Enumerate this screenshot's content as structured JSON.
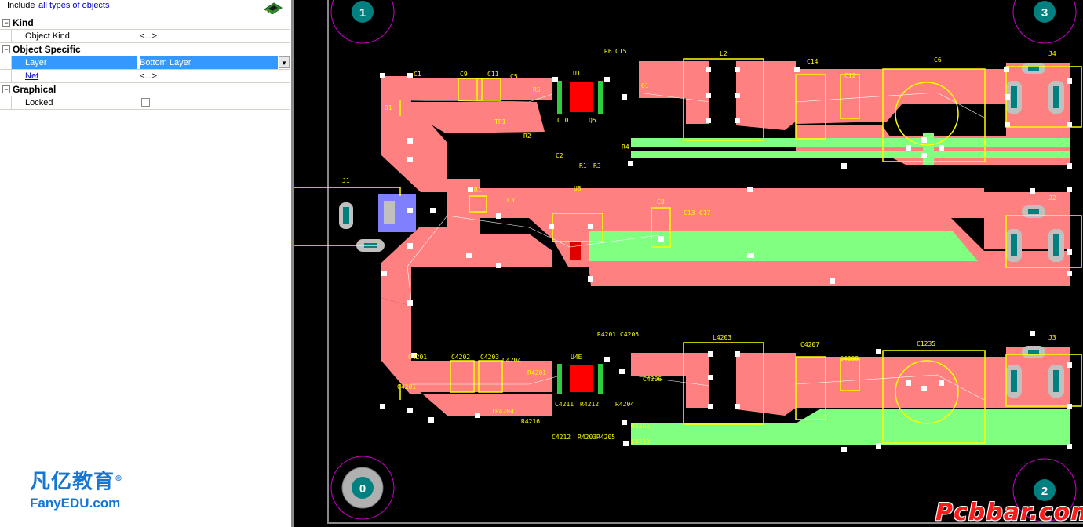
{
  "inspector": {
    "include_label": "Include",
    "include_link": "all types of objects",
    "categories": {
      "kind": "Kind",
      "object_specific": "Object Specific",
      "graphical": "Graphical"
    },
    "properties": {
      "object_kind": {
        "name": "Object Kind",
        "value": "<...>"
      },
      "layer": {
        "name": "Layer",
        "value": "Bottom Layer"
      },
      "net": {
        "name": "Net",
        "value": "<...>"
      },
      "locked": {
        "name": "Locked",
        "checked": false
      }
    },
    "toggle_symbol": "−"
  },
  "logo": {
    "cn_text": "凡亿教育",
    "reg_mark": "®",
    "en_text": "FanyEDU.com"
  },
  "watermark": "Pcbbar.com",
  "pcb": {
    "colors": {
      "board": "#000000",
      "top_copper": "#ff8080",
      "bottom_copper": "#80ff80",
      "overlay": "#ffff00",
      "mech": "#cc00cc",
      "pad": "#c0c0c0",
      "selected": "#8080ff"
    },
    "mount_holes": [
      "1",
      "3",
      "0",
      "2"
    ],
    "designators": {
      "top": [
        "L2",
        "C14",
        "C12",
        "C6",
        "J4",
        "R6",
        "C15",
        "U1",
        "Q1",
        "C9",
        "C11",
        "C5",
        "R5",
        "C1",
        "D1",
        "TP1",
        "R2",
        "C10",
        "Q5",
        "C2",
        "R1",
        "R3",
        "R4"
      ],
      "mid": [
        "J1",
        "R1",
        "C3",
        "U5",
        "C8",
        "C13",
        "C17",
        "J2"
      ],
      "bottom": [
        "L4203",
        "C4207",
        "C4208",
        "C1235",
        "J3",
        "R4201",
        "C4205",
        "U4E",
        "C4201",
        "C4203",
        "C4202",
        "C4204",
        "R4201",
        "C4201",
        "TP4204",
        "C4211",
        "R4212",
        "C4206",
        "C4212",
        "R4216",
        "R4203",
        "R4205",
        "R4204",
        "R4201",
        "C4210"
      ]
    }
  }
}
